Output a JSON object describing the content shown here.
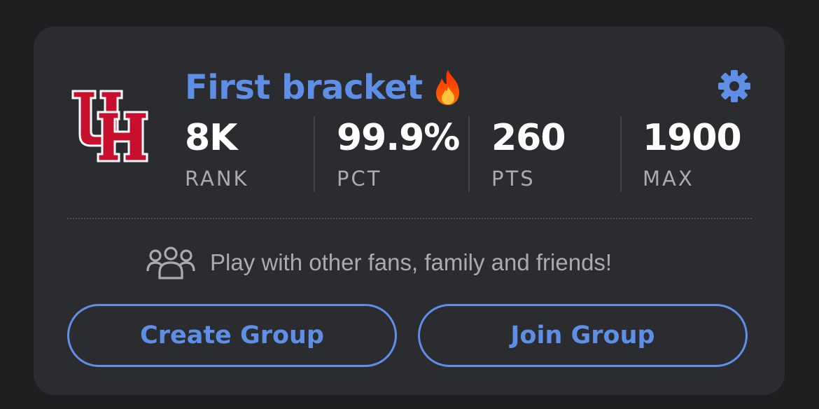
{
  "bracket": {
    "title": "First bracket",
    "title_emoji_icon": "fire-icon",
    "settings_icon": "gear-icon",
    "team_logo": "uh-logo"
  },
  "stats": [
    {
      "value": "8K",
      "label": "RANK"
    },
    {
      "value": "99.9%",
      "label": "PCT"
    },
    {
      "value": "260",
      "label": "PTS"
    },
    {
      "value": "1900",
      "label": "MAX"
    }
  ],
  "promo": {
    "icon": "group-icon",
    "text": "Play with other fans, family and friends!"
  },
  "buttons": {
    "create_label": "Create Group",
    "join_label": "Join Group"
  },
  "colors": {
    "accent": "#5e8ee6",
    "card_bg": "#2b2c2f",
    "page_bg": "#1e1f21",
    "logo_red": "#c8102e"
  }
}
